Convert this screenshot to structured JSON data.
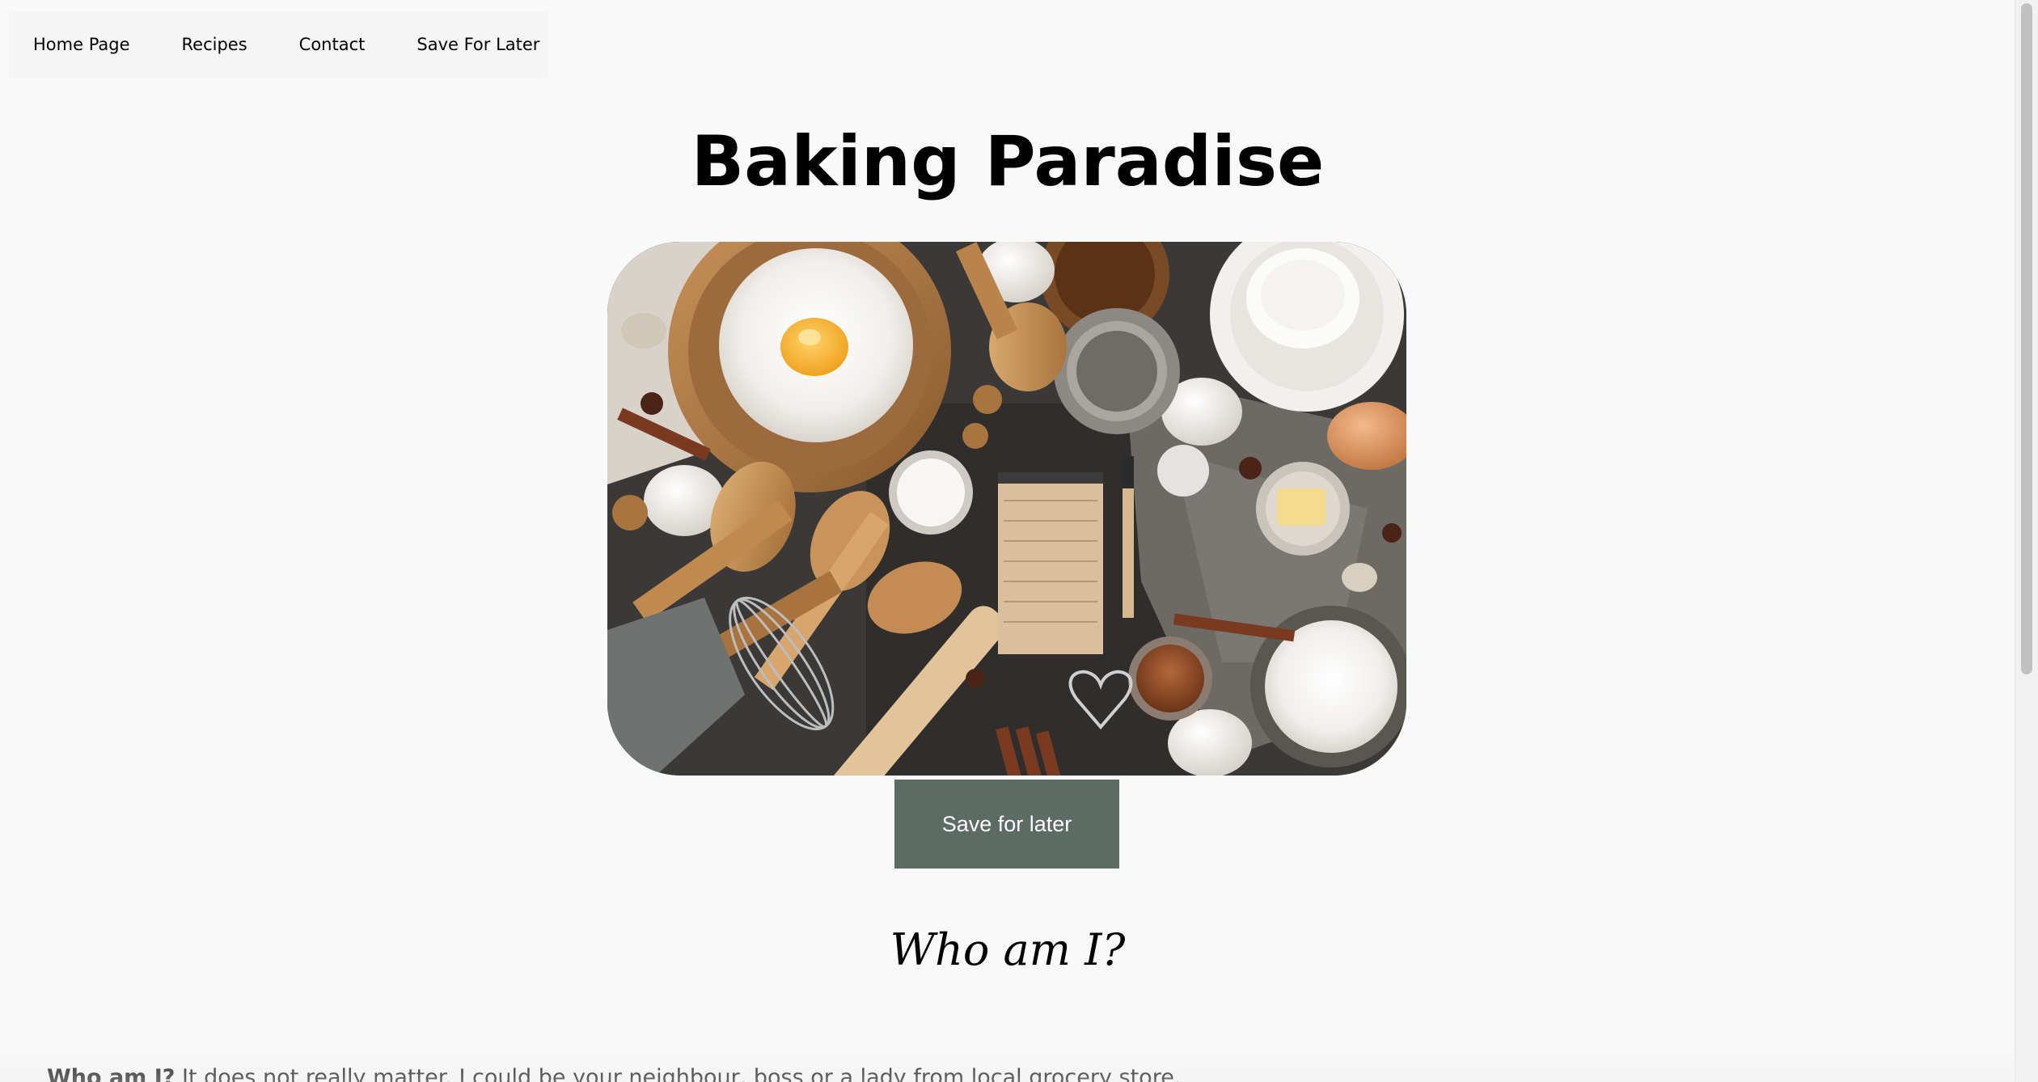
{
  "nav": {
    "items": [
      {
        "label": "Home Page"
      },
      {
        "label": "Recipes"
      },
      {
        "label": "Contact"
      },
      {
        "label": "Save For Later"
      }
    ]
  },
  "header": {
    "title": "Baking Paradise"
  },
  "hero": {
    "icon": "baking-ingredients-photo"
  },
  "actions": {
    "save_label": "Save for later"
  },
  "about": {
    "heading": "Who am I?",
    "lead_bold": "Who am I?",
    "text": " It does not really matter. I could be your neighbour, boss or a lady from local grocery store."
  },
  "colors": {
    "background": "#f9f9f9",
    "nav_background": "#f5f5f5",
    "button": "#5d6b65"
  }
}
